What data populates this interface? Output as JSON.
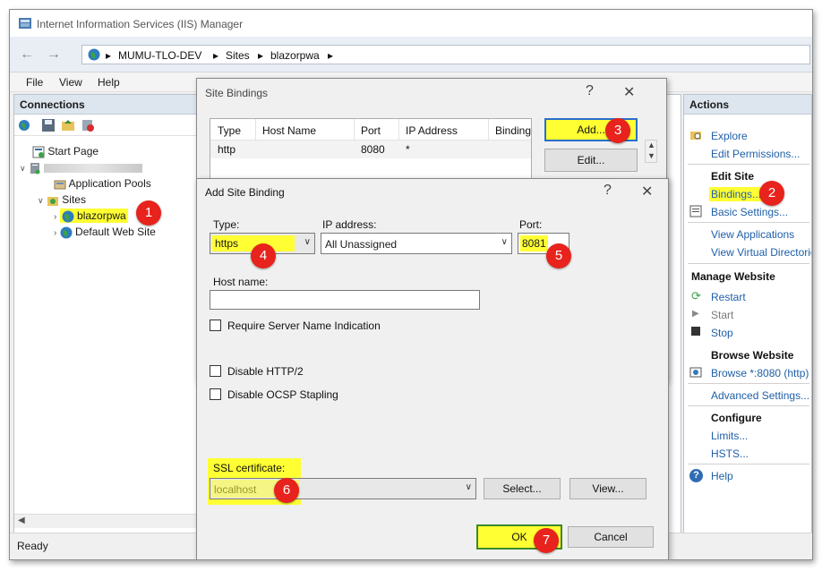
{
  "window": {
    "title": "Internet Information Services (IIS) Manager",
    "breadcrumb": [
      "MUMU-TLO-DEV",
      "Sites",
      "blazorpwa"
    ],
    "menu": [
      "File",
      "View",
      "Help"
    ],
    "status": "Ready"
  },
  "connections": {
    "header": "Connections",
    "tree": {
      "start_page": "Start Page",
      "server": "",
      "app_pools": "Application Pools",
      "sites": "Sites",
      "site_selected": "blazorpwa",
      "site_default": "Default Web Site"
    }
  },
  "actions": {
    "header": "Actions",
    "explore": "Explore",
    "edit_permissions": "Edit Permissions...",
    "edit_site_header": "Edit Site",
    "bindings": "Bindings...",
    "basic_settings": "Basic Settings...",
    "view_applications": "View Applications",
    "view_virtual_dirs": "View Virtual Directories",
    "manage_header": "Manage Website",
    "restart": "Restart",
    "start": "Start",
    "stop": "Stop",
    "browse_header": "Browse Website",
    "browse_link": "Browse *:8080 (http)",
    "advanced_settings": "Advanced Settings...",
    "configure_header": "Configure",
    "limits": "Limits...",
    "hsts": "HSTS...",
    "help": "Help"
  },
  "site_bindings": {
    "title": "Site Bindings",
    "help": "?",
    "close": "✕",
    "columns": [
      "Type",
      "Host Name",
      "Port",
      "IP Address",
      "Binding"
    ],
    "rows": [
      {
        "type": "http",
        "host": "",
        "port": "8080",
        "ip": "*",
        "binding": ""
      }
    ],
    "add_label": "Add...",
    "edit_label": "Edit..."
  },
  "add_binding": {
    "title": "Add Site Binding",
    "help": "?",
    "close": "✕",
    "type_label": "Type:",
    "type_value": "https",
    "ip_label": "IP address:",
    "ip_value": "All Unassigned",
    "port_label": "Port:",
    "port_value": "8081",
    "host_label": "Host name:",
    "host_value": "",
    "sni_label": "Require Server Name Indication",
    "http2_label": "Disable HTTP/2",
    "ocsp_label": "Disable OCSP Stapling",
    "ssl_label": "SSL certificate:",
    "ssl_value": "localhost",
    "select_label": "Select...",
    "view_label": "View...",
    "ok_label": "OK",
    "cancel_label": "Cancel"
  },
  "badges": [
    "1",
    "2",
    "3",
    "4",
    "5",
    "6",
    "7"
  ],
  "colors": {
    "highlight": "#ffff33",
    "badge": "#e8221c",
    "link": "#1f5fa8"
  }
}
